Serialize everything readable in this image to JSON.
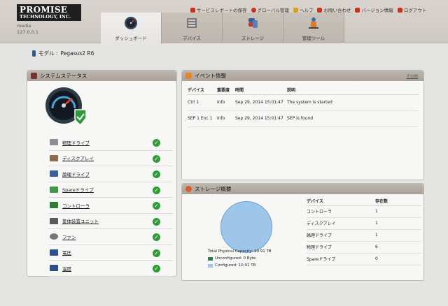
{
  "brand": {
    "line1": "PROMISE",
    "line2": "TECHNOLOGY, INC."
  },
  "host": {
    "name": "media",
    "ip": "127.0.0.1"
  },
  "toplinks": [
    {
      "label": "サービスレポートの保存",
      "color": "#c9341f"
    },
    {
      "label": "グローバル管理",
      "color": "#c9341f"
    },
    {
      "label": "ヘルプ",
      "color": "#c9341f"
    },
    {
      "label": "お問い合わせ",
      "color": "#c9341f"
    },
    {
      "label": "バージョン情報",
      "color": "#c9341f"
    },
    {
      "label": "ログアウト",
      "color": "#c9341f"
    }
  ],
  "tabs": [
    {
      "label": "ダッシュボード",
      "icon": "gauge-icon",
      "active": true
    },
    {
      "label": "デバイス",
      "icon": "device-icon"
    },
    {
      "label": "ストレージ",
      "icon": "storage-icon"
    },
    {
      "label": "管理ツール",
      "icon": "admin-tools-icon"
    }
  ],
  "model": {
    "label": "モデル :",
    "value": "Pegasus2 R6"
  },
  "system_status": {
    "title": "システムステータス",
    "items": [
      {
        "label": "物理ドライブ",
        "icon": "physical-drive-icon",
        "color": "#8a8f96"
      },
      {
        "label": "ディスクアレイ",
        "icon": "disk-array-icon",
        "color": "#8a6a4b"
      },
      {
        "label": "論理ドライブ",
        "icon": "logical-drive-icon",
        "color": "#3b5f9a"
      },
      {
        "label": "Spareドライブ",
        "icon": "spare-drive-icon",
        "color": "#3f9a45"
      },
      {
        "label": "コントローラ",
        "icon": "controller-icon",
        "color": "#2e7d32"
      },
      {
        "label": "筐体装置ユニット",
        "icon": "enclosure-icon",
        "color": "#5a5a5a"
      },
      {
        "label": "ファン",
        "icon": "fan-icon",
        "color": "#777777"
      },
      {
        "label": "電圧",
        "icon": "voltage-icon",
        "color": "#2f4f8f"
      },
      {
        "label": "温度",
        "icon": "temperature-icon",
        "color": "#2f4f8f"
      }
    ]
  },
  "events": {
    "title": "イベント情報",
    "more": "その他",
    "headers": [
      "デバイス",
      "重要度",
      "時間",
      "説明"
    ],
    "rows": [
      [
        "Ctrl 1",
        "Info",
        "Sep 29, 2014 15:01:47",
        "The system is started"
      ],
      [
        "SEP 1 Enc 1",
        "Info",
        "Sep 29, 2014 15:01:47",
        "SEP is found"
      ]
    ]
  },
  "storage": {
    "title": "ストレージ概要",
    "total": "Total Physical Capacity: 10.91 TB",
    "unconfigured": "Unconfigured: 0 Byte",
    "configured": "Configured: 10.91 TB",
    "colors": {
      "unconfigured": "#2e7d4f",
      "configured": "#9dc6ea"
    },
    "headers": [
      "デバイス",
      "存在数"
    ],
    "rows": [
      [
        "コントローラ",
        "1"
      ],
      [
        "ディスクアレイ",
        "1"
      ],
      [
        "論理ドライブ",
        "1"
      ],
      [
        "物理ドライブ",
        "6"
      ],
      [
        "Spareドライブ",
        "0"
      ]
    ]
  }
}
